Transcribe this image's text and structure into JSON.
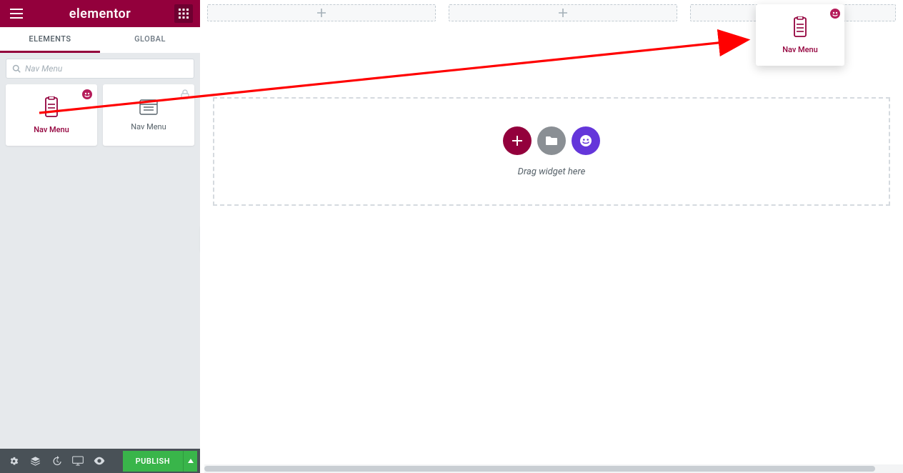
{
  "header": {
    "title": "elementor"
  },
  "tabs": {
    "elements": "ELEMENTS",
    "global": "GLOBAL"
  },
  "search": {
    "placeholder": "Nav Menu",
    "value": "Nav Menu"
  },
  "widgets": {
    "brand_label": "Nav Menu",
    "plain_label": "Nav Menu"
  },
  "drag_ghost": {
    "label": "Nav Menu"
  },
  "canvas": {
    "drop_hint": "Drag widget here"
  },
  "footer": {
    "publish": "PUBLISH"
  },
  "colors": {
    "brand": "#93003c",
    "success": "#39b54a",
    "purple": "#6436da",
    "grey": "#8a8f94"
  }
}
